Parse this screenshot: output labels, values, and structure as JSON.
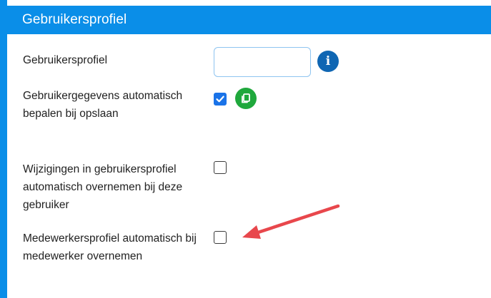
{
  "panel": {
    "title": "Gebruikersprofiel",
    "accent_color": "#0a8ee8"
  },
  "fields": [
    {
      "label": "Gebruikersprofiel",
      "control": "text-input",
      "value": "",
      "icon": "info-icon"
    },
    {
      "label": "Gebruikergegevens automatisch bepalen bij opslaan",
      "control": "checkbox",
      "checked": true,
      "icon": "copy-icon"
    },
    {
      "label": "Wijzigingen in gebruikersprofiel automatisch overnemen bij deze gebruiker",
      "control": "checkbox",
      "checked": false
    },
    {
      "label": "Medewerkersprofiel automatisch bij medewerker overnemen",
      "control": "checkbox",
      "checked": false
    }
  ],
  "icons": {
    "info": {
      "glyph": "i",
      "color": "#0f66b3"
    },
    "copy": {
      "color": "#1fa83c"
    }
  },
  "annotation": {
    "type": "arrow",
    "color": "#e8474c",
    "points_to": "Medewerkersprofiel checkbox"
  }
}
